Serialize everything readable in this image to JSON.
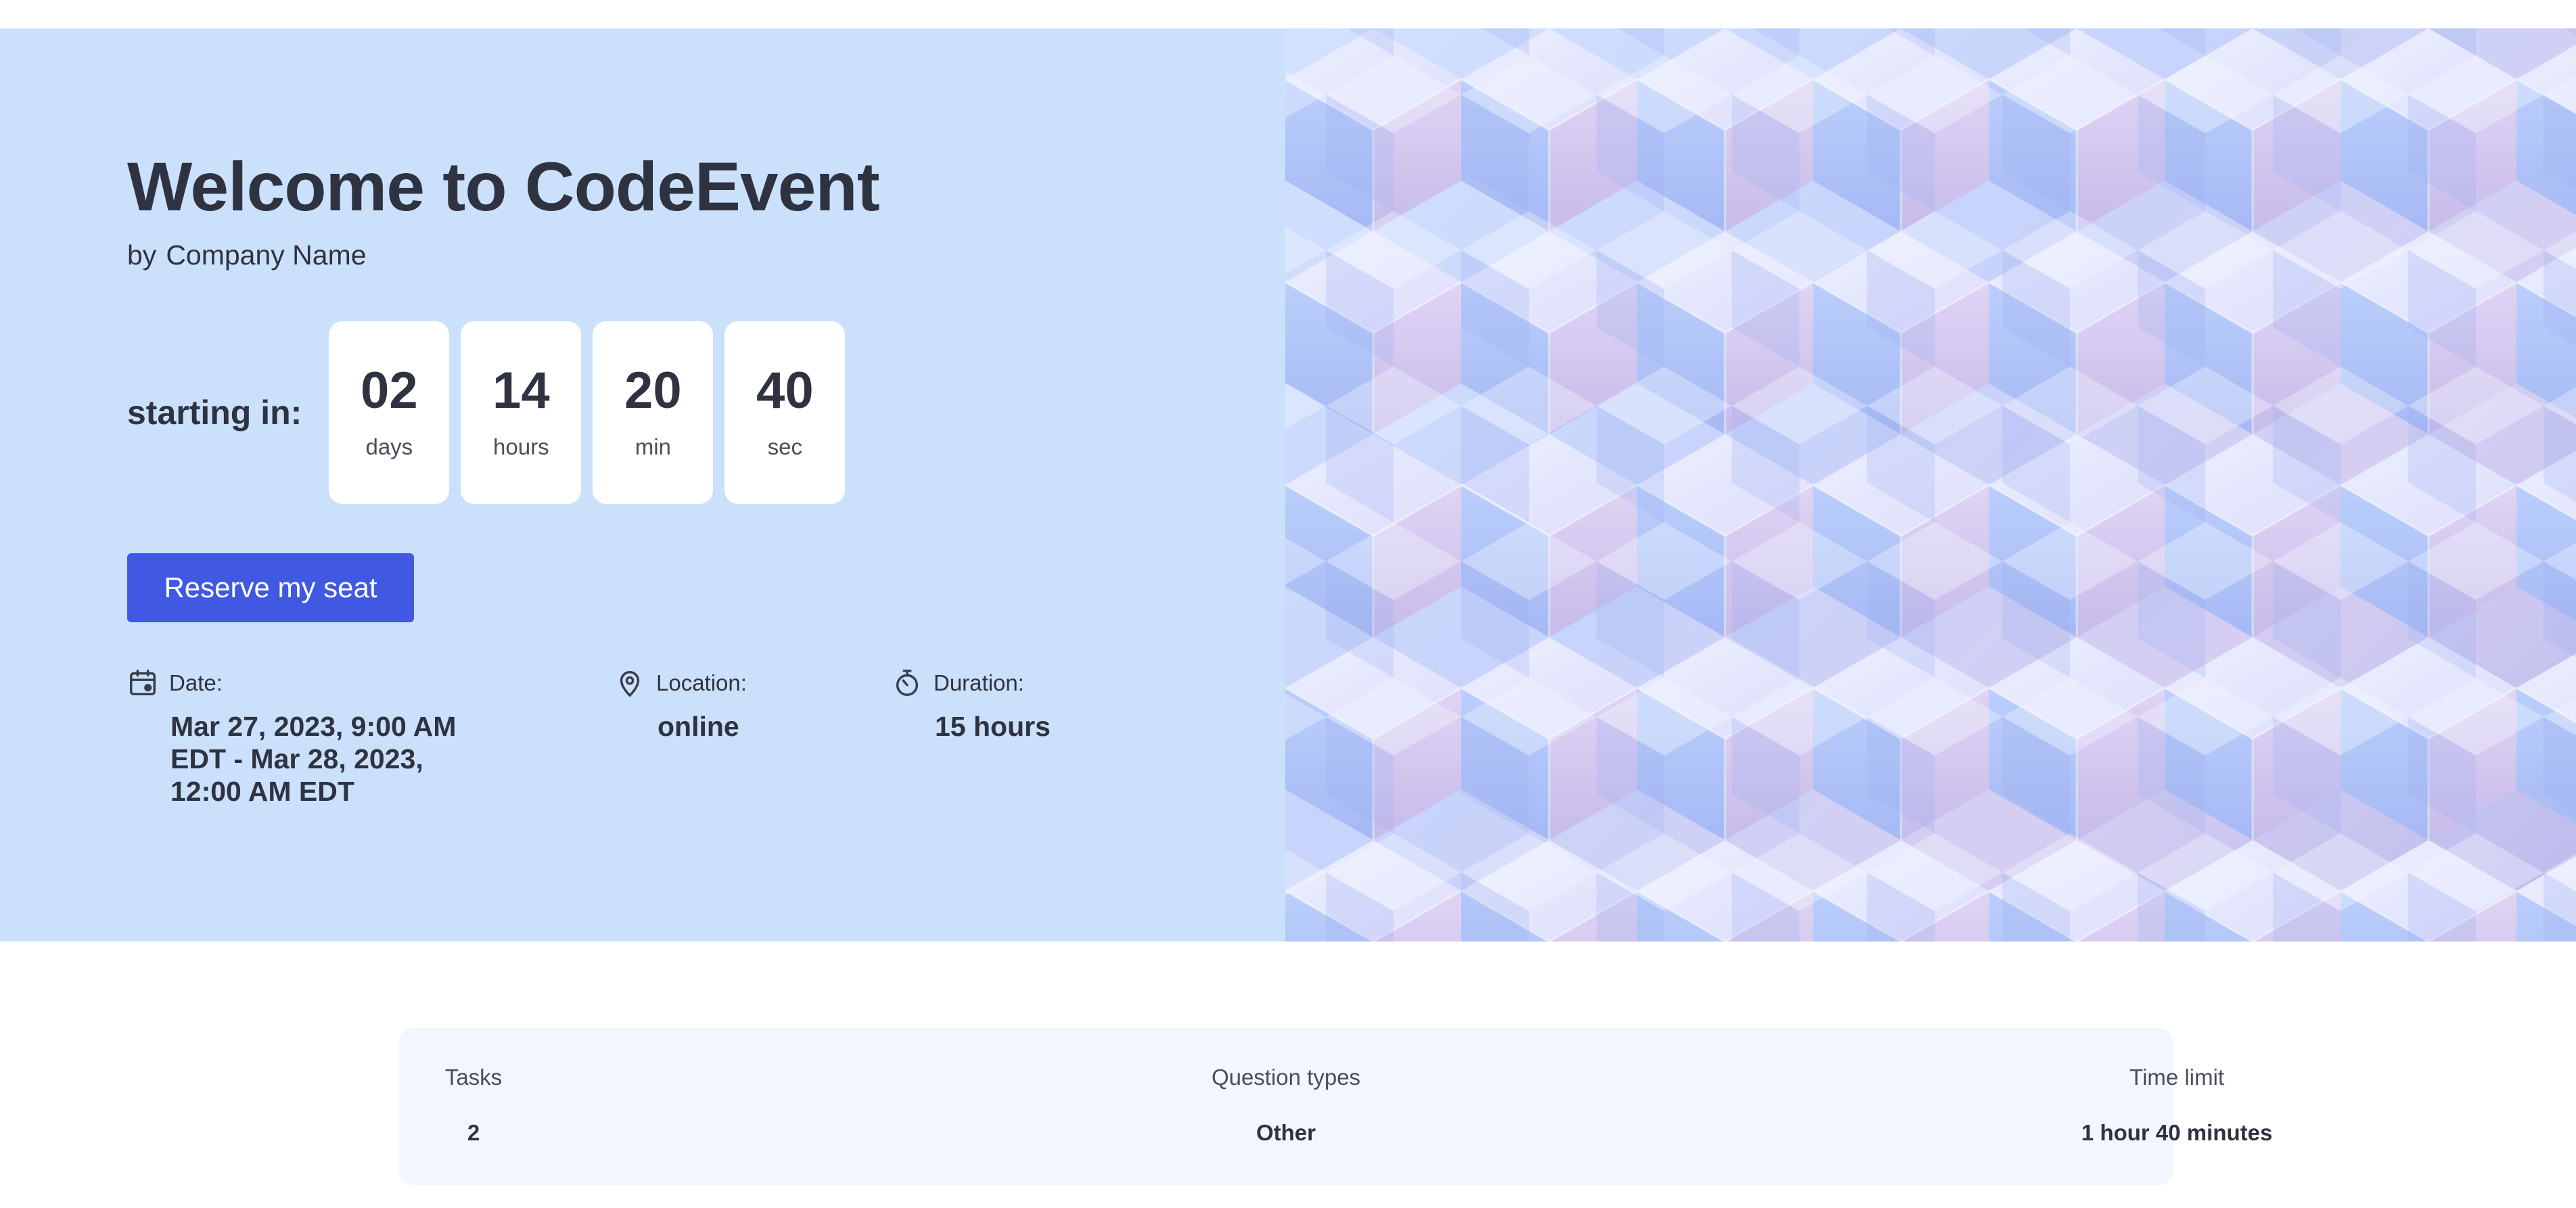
{
  "hero": {
    "title": "Welcome to CodeEvent",
    "by_prefix": "by",
    "company": "Company Name",
    "starting_label": "starting in:",
    "countdown": [
      {
        "value": "02",
        "unit": "days"
      },
      {
        "value": "14",
        "unit": "hours"
      },
      {
        "value": "20",
        "unit": "min"
      },
      {
        "value": "40",
        "unit": "sec"
      }
    ],
    "reserve_label": "Reserve my seat",
    "info": {
      "date": {
        "label": "Date:",
        "value_lines": [
          "Mar 27, 2023, 9:00 AM",
          "EDT - Mar 28, 2023,",
          "12:00 AM EDT"
        ],
        "icon": "calendar-icon"
      },
      "location": {
        "label": "Location:",
        "value": "online",
        "icon": "location-pin-icon"
      },
      "duration": {
        "label": "Duration:",
        "value": "15 hours",
        "icon": "stopwatch-icon"
      }
    }
  },
  "stats": [
    {
      "label": "Tasks",
      "value": "2"
    },
    {
      "label": "Question types",
      "value": "Other"
    },
    {
      "label": "Time limit",
      "value": "1 hour 40 minutes"
    }
  ],
  "colors": {
    "hero_bg": "#cbe1fb",
    "accent": "#4158e2",
    "text": "#2f3240",
    "stats_bg": "#f2f6fe"
  }
}
